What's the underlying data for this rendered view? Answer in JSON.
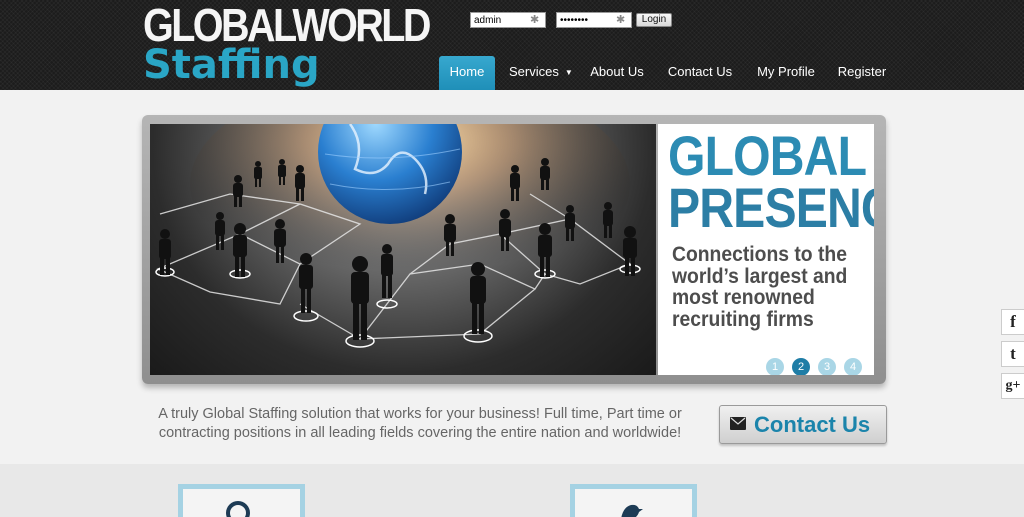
{
  "logo": {
    "line1": "GLOBALWORLD",
    "line2": "Staffing"
  },
  "login": {
    "username": "admin",
    "password": "••••••••",
    "button": "Login"
  },
  "nav": {
    "items": [
      {
        "label": "Home",
        "active": true
      },
      {
        "label": "Services",
        "caret": "▼"
      },
      {
        "label": "About Us"
      },
      {
        "label": "Contact Us"
      },
      {
        "label": "My Profile"
      },
      {
        "label": "Register"
      }
    ]
  },
  "slide": {
    "headline1": "GLOBAL",
    "headline2": "PRESENCE",
    "tagline": "Connections to the world’s largest and most renowned recruiting firms",
    "dots": [
      "1",
      "2",
      "3",
      "4"
    ],
    "active_dot": 2
  },
  "social": {
    "items": [
      "f",
      "t",
      "g+"
    ]
  },
  "intro": {
    "text": "A truly Global Staffing solution that works for your business! Full time, Part time or contracting positions in all leading fields covering the entire nation and worldwide!"
  },
  "cta": {
    "label": "Contact Us"
  },
  "colors": {
    "accent": "#2aa6c6",
    "header": "#1c1c1c",
    "headline": "#2c8bb3",
    "dot": "#a9d6e6",
    "dot_active": "#1f7da6"
  },
  "icons": {
    "cta": "envelope-icon",
    "feature1": "search-icon",
    "feature2": "bird-icon",
    "login_field": "keyboard-icon"
  }
}
